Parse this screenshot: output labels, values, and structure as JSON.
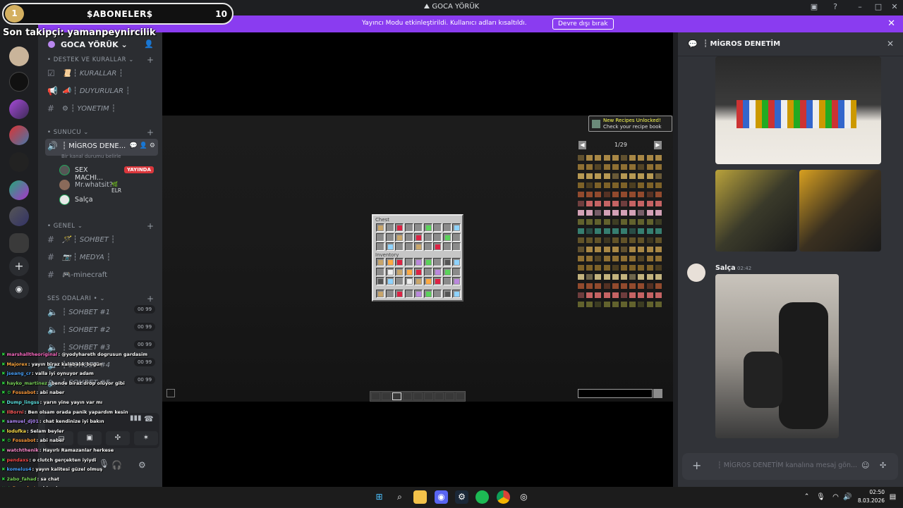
{
  "window": {
    "title": "GOCA YÖRÜK"
  },
  "streamer_banner": {
    "message": "Yayıncı Modu etkinleştirildi. Kullanıcı adları kısaltıldı.",
    "disable_label": "Devre dışı bırak",
    "color": "#8a3cf0"
  },
  "overlay": {
    "sub_count_left": "1",
    "sub_label": "$ABONELER$",
    "sub_count_right": "10",
    "last_follower": "Son takipçi: yamanpeynircilik"
  },
  "server": {
    "name": "GOCA YÖRÜK",
    "categories": [
      {
        "name": "DESTEK VE KURALLAR",
        "channels": [
          {
            "icon": "rules-icon",
            "emoji": "📜",
            "label": "┆ KURALLAR ┆"
          },
          {
            "icon": "megaphone-icon",
            "emoji": "📣",
            "label": "┆ DUYURULAR ┆"
          },
          {
            "icon": "hash-icon",
            "emoji": "⚙",
            "label": "┆ YONETIM ┆"
          }
        ]
      },
      {
        "name": "SUNUCU"
      },
      {
        "name": "GENEL",
        "channels": [
          {
            "icon": "hash-icon",
            "emoji": "🪄",
            "label": "┆ SOHBET ┆"
          },
          {
            "icon": "hash-icon",
            "emoji": "📷",
            "label": "┆ MEDYA ┆"
          },
          {
            "icon": "hash-icon",
            "emoji": "🎮",
            "label": "-minecraft"
          }
        ]
      },
      {
        "name": "SES ODALARI"
      }
    ],
    "active_voice": {
      "name": "┆ MİGROS DENE...",
      "status": "Bir kanal durumu belirle",
      "users": [
        {
          "name": "SEX MACHI...",
          "badge": "YAYINDA"
        },
        {
          "name": "Mr.whatsit?",
          "tag": "ELR"
        },
        {
          "name": "Salça"
        }
      ]
    },
    "voice_rooms": [
      {
        "label": "┆ SOHBET #1",
        "count_a": "00",
        "count_b": "99"
      },
      {
        "label": "┆ SOHBET #2",
        "count_a": "00",
        "count_b": "99"
      },
      {
        "label": "┆ SOHBET #3",
        "count_a": "00",
        "count_b": "99"
      },
      {
        "label": "┆ SOHBET #4",
        "count_a": "00",
        "count_b": "99"
      },
      {
        "label": "┆ SOHBET #5",
        "count_a": "00",
        "count_b": "99"
      }
    ]
  },
  "game": {
    "chest_title": "Chest",
    "inventory_title": "Inventory",
    "recipe_toast": {
      "line1": "New Recipes Unlocked!",
      "line2": "Check your recipe book"
    },
    "recipe_page": "1/29"
  },
  "chat_panel": {
    "channel": "┆ MİGROS DENETİM",
    "message_author": "Salça",
    "message_time": "02:42",
    "composer_placeholder": "┆ MİGROS DENETİM kanalına mesaj gön..."
  },
  "twitch_chat": [
    {
      "user": "marshalltheoriginal",
      "color": "#ff6ec7",
      "text": ": @yodyhareth dogrusun gardasim"
    },
    {
      "user": "Majorex",
      "color": "#ffa940",
      "text": ": yayın biraz kalabalık bugün"
    },
    {
      "user": "jseang_cr",
      "color": "#4aa3ff",
      "text": ": valla iyi oynuyor adam"
    },
    {
      "user": "hayko_martinez",
      "color": "#7bd35c",
      "text": ": bende biraz drop oluyor gibi"
    },
    {
      "user": "Fossabot",
      "color": "#ff9c3d",
      "text": ": abi naber",
      "bot": true
    },
    {
      "user": "Dump_lingss",
      "color": "#5ee3e3",
      "text": ": yarın yine yayın var mı"
    },
    {
      "user": "IlBorni",
      "color": "#ff5c5c",
      "text": ": Ben olsam orada panik yapardım kesin"
    },
    {
      "user": "samuel_dj01",
      "color": "#b38bff",
      "text": ": chat kendinize iyi bakın"
    },
    {
      "user": "lodufka",
      "color": "#ffe14d",
      "text": ": Selam beyler"
    },
    {
      "user": "Fossabot",
      "color": "#ff9c3d",
      "text": ": abi naber",
      "bot": true
    },
    {
      "user": "watchthenik",
      "color": "#ff8fd1",
      "text": ": Hayırlı Ramazanlar herkese"
    },
    {
      "user": "pendaxs",
      "color": "#ff4d4d",
      "text": ": o clutch gerçekten iyiydi"
    },
    {
      "user": "komelus4",
      "color": "#4aa3ff",
      "text": ": yayın kalitesi güzel olmuş"
    },
    {
      "user": "2abo_fahad",
      "color": "#7bd35c",
      "text": ": sa chat"
    },
    {
      "user": "Fossabot",
      "color": "#ff9c3d",
      "text": ": abi naber",
      "bot": true
    },
    {
      "user": "4_ris3",
      "color": "#5ee3e3",
      "text": ": yarın da yayın açacak mısın"
    }
  ],
  "taskbar": {
    "time": "02:50",
    "date": "8.03.2026"
  }
}
